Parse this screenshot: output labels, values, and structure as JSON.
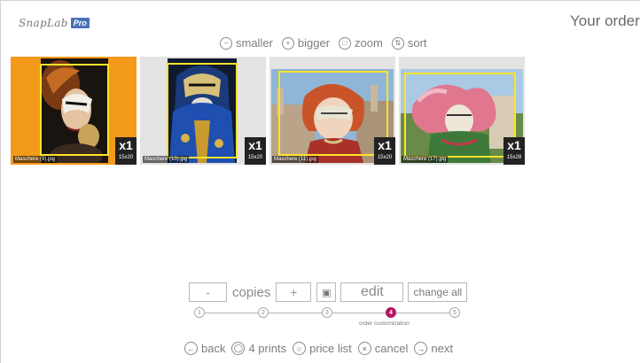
{
  "app": {
    "logo_text": "SnapLab",
    "logo_badge": "Pro"
  },
  "header": {
    "title": "Your order"
  },
  "view_toolbar": {
    "smaller": "smaller",
    "bigger": "bigger",
    "zoom": "zoom",
    "sort": "sort"
  },
  "photos": [
    {
      "filename": "Maschere (9).jpg",
      "copies": "x1",
      "size": "15x20",
      "selected": true
    },
    {
      "filename": "Maschere (10).jpg",
      "copies": "x1",
      "size": "15x20",
      "selected": false
    },
    {
      "filename": "Maschere (11).jpg",
      "copies": "x1",
      "size": "15x20",
      "selected": false
    },
    {
      "filename": "Maschere (17).jpg",
      "copies": "x1",
      "size": "15x28",
      "selected": false
    }
  ],
  "controls": {
    "minus": "-",
    "copies": "copies",
    "plus": "+",
    "edit": "edit",
    "change_all": "change all"
  },
  "steps": {
    "items": [
      "1",
      "2",
      "3",
      "4",
      "5"
    ],
    "active_index": 3,
    "active_label": "order customization"
  },
  "bottom_nav": {
    "back": "back",
    "prints": "4 prints",
    "price_list": "price list",
    "cancel": "cancel",
    "next": "next"
  },
  "colors": {
    "selected": "#f39a1b",
    "crop_frame": "#ffe32b",
    "step_active": "#b2185f",
    "logo_badge": "#4a72b5"
  }
}
